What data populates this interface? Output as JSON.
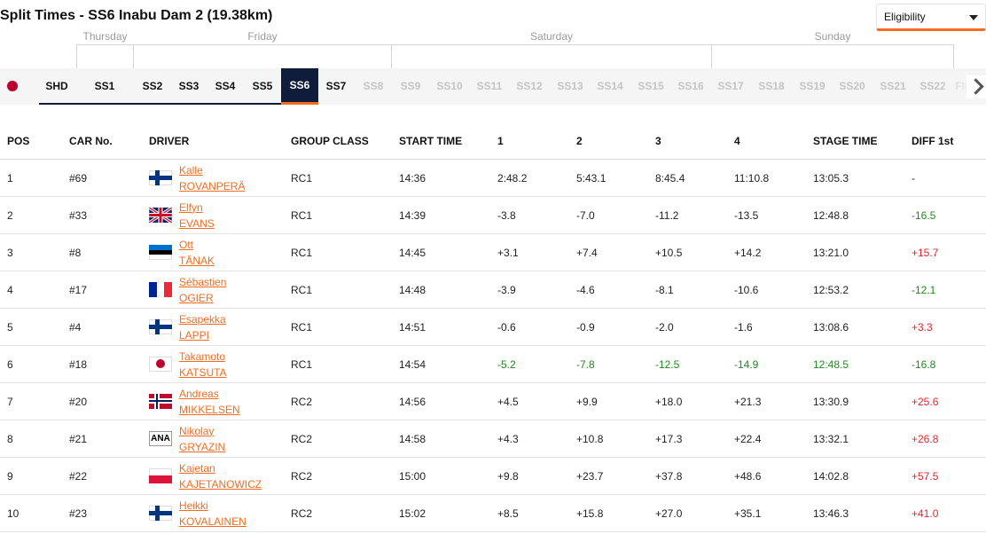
{
  "title": "Split Times - SS6 Inabu Dam 2 (19.38km)",
  "eligibility": {
    "label": "Eligibility"
  },
  "days": [
    "Thursday",
    "Friday",
    "Saturday",
    "Sunday"
  ],
  "stages": [
    "SHD",
    "SS1",
    "SS2",
    "SS3",
    "SS4",
    "SS5",
    "SS6",
    "SS7",
    "SS8",
    "SS9",
    "SS10",
    "SS11",
    "SS12",
    "SS13",
    "SS14",
    "SS15",
    "SS16",
    "SS17",
    "SS18",
    "SS19",
    "SS20",
    "SS21",
    "SS22",
    "FINAL"
  ],
  "active_stage": "SS6",
  "table": {
    "headers": [
      "POS",
      "CAR No.",
      "DRIVER",
      "GROUP CLASS",
      "START TIME",
      "1",
      "2",
      "3",
      "4",
      "STAGE TIME",
      "DIFF 1st"
    ],
    "rows": [
      {
        "pos": "1",
        "car": "#69",
        "first": "Kalle",
        "last": "ROVANPERÄ",
        "flag": "fi",
        "group": "RC1",
        "start": "14:36",
        "s1": "2:48.2",
        "s2": "5:43.1",
        "s3": "8:45.4",
        "s4": "11:10.8",
        "stage": "13:05.3",
        "diff": "-"
      },
      {
        "pos": "2",
        "car": "#33",
        "first": "Elfyn",
        "last": "EVANS",
        "flag": "gb",
        "group": "RC1",
        "start": "14:39",
        "s1": "-3.8",
        "s2": "-7.0",
        "s3": "-11.2",
        "s4": "-13.5",
        "stage": "12:48.8",
        "diff": "-16.5"
      },
      {
        "pos": "3",
        "car": "#8",
        "first": "Ott",
        "last": "TÄNAK",
        "flag": "ee",
        "group": "RC1",
        "start": "14:45",
        "s1": "+3.1",
        "s2": "+7.4",
        "s3": "+10.5",
        "s4": "+14.2",
        "stage": "13:21.0",
        "diff": "+15.7"
      },
      {
        "pos": "4",
        "car": "#17",
        "first": "Sébastien",
        "last": "OGIER",
        "flag": "fr",
        "group": "RC1",
        "start": "14:48",
        "s1": "-3.9",
        "s2": "-4.6",
        "s3": "-8.1",
        "s4": "-10.6",
        "stage": "12:53.2",
        "diff": "-12.1"
      },
      {
        "pos": "5",
        "car": "#4",
        "first": "Esapekka",
        "last": "LAPPI",
        "flag": "fi",
        "group": "RC1",
        "start": "14:51",
        "s1": "-0.6",
        "s2": "-0.9",
        "s3": "-2.0",
        "s4": "-1.6",
        "stage": "13:08.6",
        "diff": "+3.3"
      },
      {
        "pos": "6",
        "car": "#18",
        "first": "Takamoto",
        "last": "KATSUTA",
        "flag": "jp",
        "group": "RC1",
        "start": "14:54",
        "s1": "-5.2",
        "s2": "-7.8",
        "s3": "-12.5",
        "s4": "-14.9",
        "stage": "12:48.5",
        "diff": "-16.8",
        "green": true
      },
      {
        "pos": "7",
        "car": "#20",
        "first": "Andreas",
        "last": "MIKKELSEN",
        "flag": "no",
        "group": "RC2",
        "start": "14:56",
        "s1": "+4.5",
        "s2": "+9.9",
        "s3": "+18.0",
        "s4": "+21.3",
        "stage": "13:30.9",
        "diff": "+25.6"
      },
      {
        "pos": "8",
        "car": "#21",
        "first": "Nikolay",
        "last": "GRYAZIN",
        "flag": "ana",
        "flag_text": "ANA",
        "group": "RC2",
        "start": "14:58",
        "s1": "+4.3",
        "s2": "+10.8",
        "s3": "+17.3",
        "s4": "+22.4",
        "stage": "13:32.1",
        "diff": "+26.8"
      },
      {
        "pos": "9",
        "car": "#22",
        "first": "Kajetan",
        "last": "KAJETANOWICZ",
        "flag": "pl",
        "group": "RC2",
        "start": "15:00",
        "s1": "+9.8",
        "s2": "+23.7",
        "s3": "+37.8",
        "s4": "+48.6",
        "stage": "14:02.8",
        "diff": "+57.5"
      },
      {
        "pos": "10",
        "car": "#23",
        "first": "Heikki",
        "last": "KOVALAINEN",
        "flag": "fi",
        "group": "RC2",
        "start": "15:02",
        "s1": "+8.5",
        "s2": "+15.8",
        "s3": "+27.0",
        "s4": "+35.1",
        "stage": "13:46.3",
        "diff": "+41.0"
      }
    ]
  },
  "colors": {
    "accent": "#f36c21",
    "navy": "#0f1d3b",
    "faster": "#1f8a1f",
    "slower": "#e3262b"
  }
}
